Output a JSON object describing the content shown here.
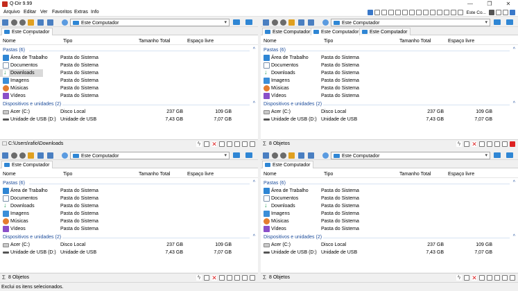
{
  "window": {
    "title": "Q-Dir 9.99",
    "minimize": "—",
    "maximize": "❐",
    "close": "✕"
  },
  "menu": [
    "Arquivo",
    "Editar",
    "Ver",
    "Favoritos",
    "Extras",
    "Info"
  ],
  "top_toolbar": {
    "location_label": "Este Co..."
  },
  "columns": {
    "name": "Nome",
    "type": "Tipo",
    "total": "Tamanho Total",
    "free": "Espaço livre"
  },
  "groups": {
    "folders": "Pastas (6)",
    "devices": "Dispositivos e unidades (2)"
  },
  "folders": [
    {
      "name": "Área de Trabalho",
      "type": "Pasta do Sistema",
      "icon": "desktop-folder-icon"
    },
    {
      "name": "Documentos",
      "type": "Pasta do Sistema",
      "icon": "documents-folder-icon"
    },
    {
      "name": "Downloads",
      "type": "Pasta do Sistema",
      "icon": "downloads-folder-icon"
    },
    {
      "name": "Imagens",
      "type": "Pasta do Sistema",
      "icon": "pictures-folder-icon"
    },
    {
      "name": "Músicas",
      "type": "Pasta do Sistema",
      "icon": "music-folder-icon"
    },
    {
      "name": "Vídeos",
      "type": "Pasta do Sistema",
      "icon": "videos-folder-icon"
    }
  ],
  "devices": [
    {
      "name": "Acer (C:)",
      "type": "Disco Local",
      "total": "237 GB",
      "free": "109 GB"
    },
    {
      "name": "Unidade de USB (D:)",
      "type": "Unidade de USB",
      "total": "7,43 GB",
      "free": "7,07 GB"
    }
  ],
  "panes": {
    "tl": {
      "address": "Este Computador",
      "tabs": [
        "Este Computador"
      ],
      "status": "C:\\Users\\rafio\\Downloads",
      "selected_row": "Downloads"
    },
    "tr": {
      "address": "Este Computador",
      "tabs": [
        "Este Computador",
        "Este Computador",
        "Este Computador"
      ],
      "status": "8 Objetos"
    },
    "bl": {
      "address": "Este Computador",
      "tabs": [
        "Este Computador"
      ],
      "status": "8 Objetos"
    },
    "br": {
      "address": "Este Computador",
      "tabs": [
        "Este Computador"
      ],
      "status": "8 Objetos"
    }
  },
  "bottom_status": "Exclui os itens selecionados.",
  "colors": {
    "accent": "#2f86d4",
    "group": "#1e4e9c",
    "close_red": "#d22222"
  }
}
